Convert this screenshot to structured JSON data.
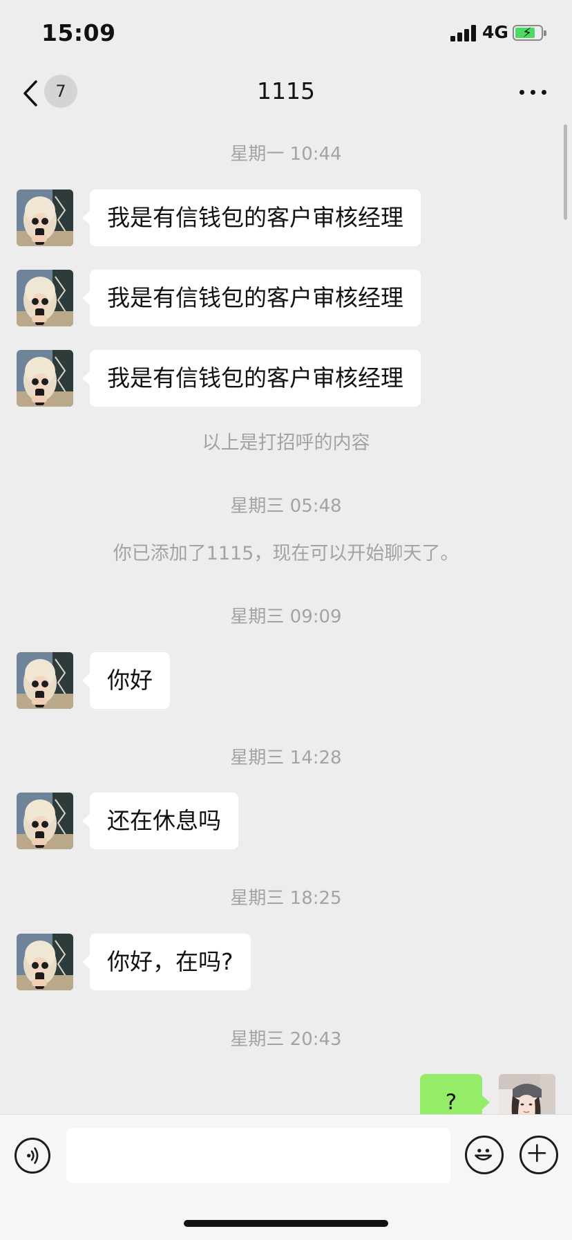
{
  "status_bar": {
    "time": "15:09",
    "network": "4G"
  },
  "nav": {
    "unread_count": "7",
    "title": "1115"
  },
  "messages": [
    {
      "type": "time",
      "text": "星期一 10:44"
    },
    {
      "type": "incoming",
      "text": "我是有信钱包的客户审核经理"
    },
    {
      "type": "incoming",
      "text": "我是有信钱包的客户审核经理"
    },
    {
      "type": "incoming",
      "text": "我是有信钱包的客户审核经理"
    },
    {
      "type": "system",
      "text": "以上是打招呼的内容"
    },
    {
      "type": "time",
      "text": "星期三 05:48"
    },
    {
      "type": "system",
      "text": "你已添加了1115，现在可以开始聊天了。"
    },
    {
      "type": "time",
      "text": "星期三 09:09"
    },
    {
      "type": "incoming",
      "text": "你好"
    },
    {
      "type": "time",
      "text": "星期三 14:28"
    },
    {
      "type": "incoming",
      "text": "还在休息吗"
    },
    {
      "type": "time",
      "text": "星期三 18:25"
    },
    {
      "type": "incoming",
      "text": "你好，在吗?"
    },
    {
      "type": "time",
      "text": "星期三 20:43"
    },
    {
      "type": "outgoing",
      "text": "?"
    }
  ],
  "input": {
    "value": "",
    "placeholder": ""
  },
  "icons": {
    "back": "chevron-left-icon",
    "more": "more-dots-icon",
    "voice": "voice-icon",
    "emoji": "emoji-icon",
    "plus": "plus-icon"
  },
  "colors": {
    "background": "#ededed",
    "incoming_bubble": "#ffffff",
    "outgoing_bubble": "#95ec69",
    "timestamp": "#a3a3a3"
  }
}
